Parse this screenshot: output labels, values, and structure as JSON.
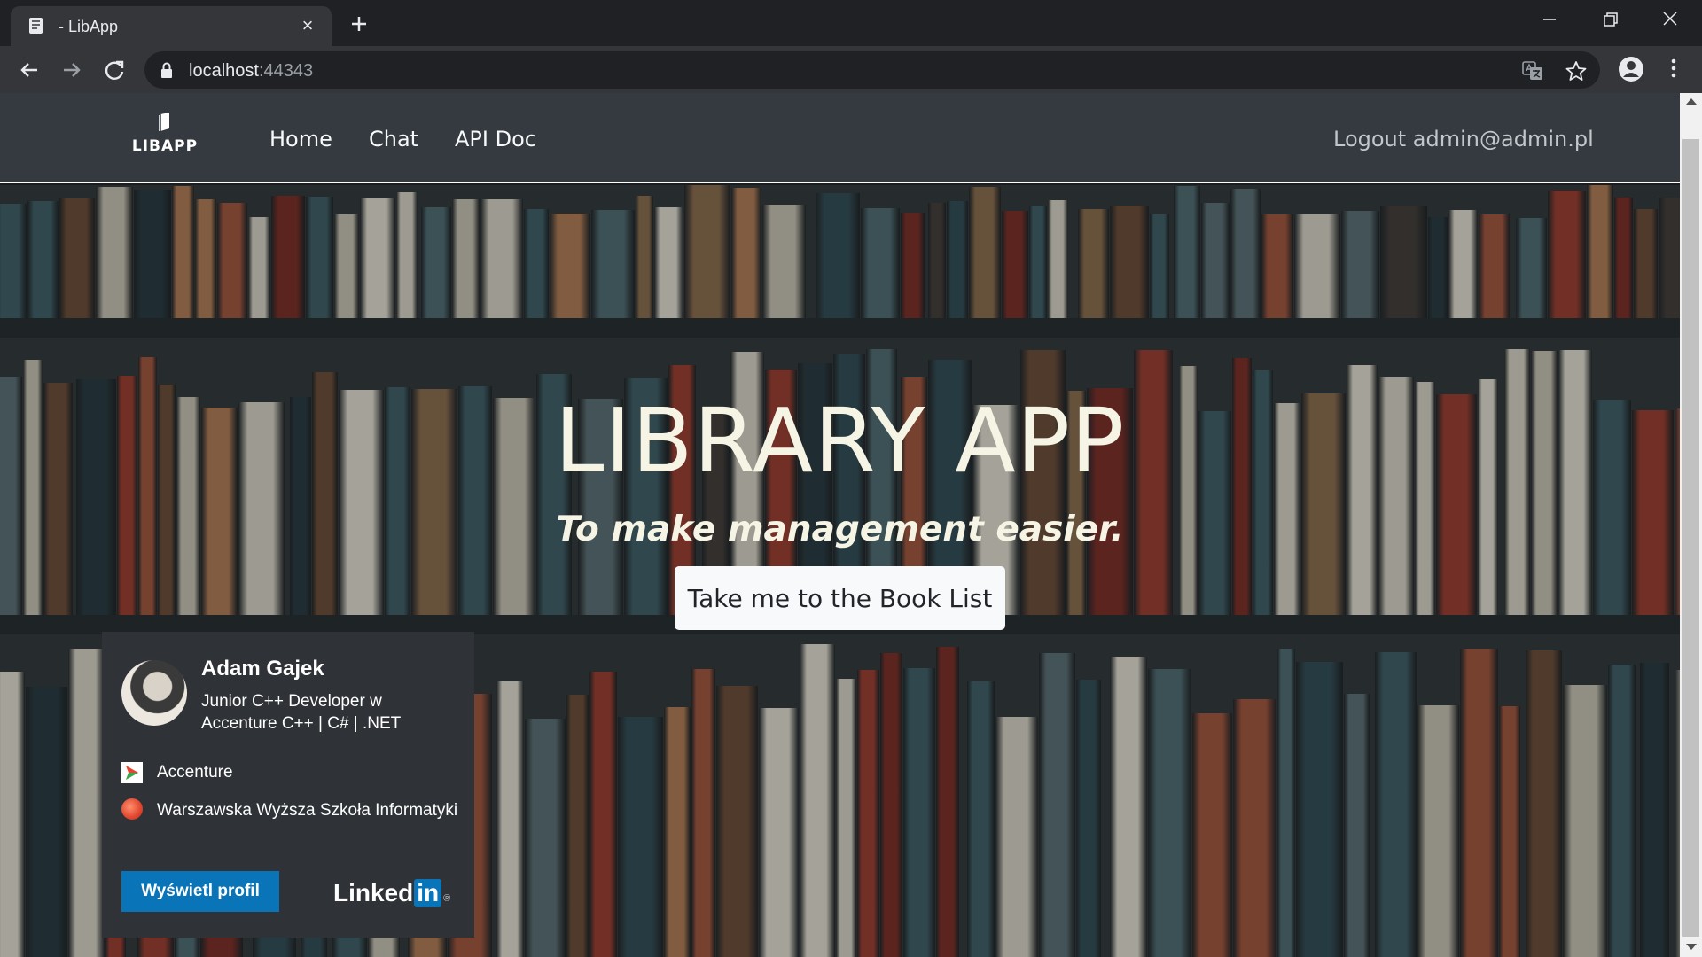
{
  "browser": {
    "tab_title": "- LibApp",
    "url_host": "localhost",
    "url_port": ":44343"
  },
  "navbar": {
    "brand": "LIBAPP",
    "links": [
      "Home",
      "Chat",
      "API Doc"
    ],
    "logout": "Logout admin@admin.pl"
  },
  "hero": {
    "title": "LIBRARY APP",
    "subtitle": "To make management easier.",
    "button": "Take me to the Book List"
  },
  "linkedin_card": {
    "name": "Adam Gajek",
    "headline": "Junior C++ Developer w Accenture C++ | C# | .NET",
    "company": "Accenture",
    "school": "Warszawska Wyższa Szkoła Informatyki",
    "button": "Wyświetl profil",
    "logo_text": "Linked",
    "logo_in": "in",
    "logo_reg": "®"
  },
  "icons": {
    "favicon": "document-icon",
    "tab_close": "close-icon",
    "new_tab": "plus-icon",
    "back": "arrow-left-icon",
    "forward": "arrow-right-icon",
    "reload": "reload-icon",
    "lock": "lock-icon",
    "translate": "translate-icon",
    "bookmark": "star-icon",
    "profile": "account-circle-icon",
    "menu": "kebab-menu-icon"
  },
  "colors": {
    "navbar": "#343a40",
    "linkedin_blue": "#0a74b8",
    "hero_text": "#f6f4e4"
  }
}
